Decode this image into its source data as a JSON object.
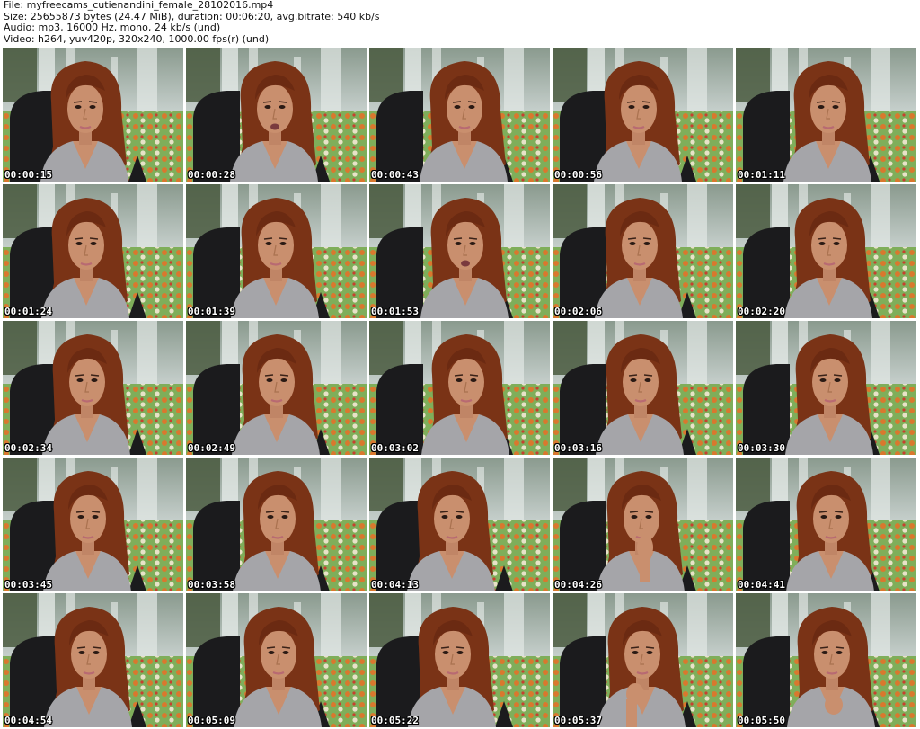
{
  "header": {
    "file": "File: myfreecams_cutienandini_female_28102016.mp4",
    "size": "Size: 25655873 bytes (24.47 MiB), duration: 00:06:20, avg.bitrate: 540 kb/s",
    "audio": "Audio: mp3, 16000 Hz, mono, 24 kb/s (und)",
    "video": "Video: h264, yuv420p, 320x240, 1000.00 fps(r) (und)"
  },
  "colors": {
    "background": "#ffffff",
    "timestamp_text": "#ffffff",
    "timestamp_outline": "#000000"
  },
  "thumbnails": [
    {
      "timestamp": "00:00:15",
      "pose": "neutral"
    },
    {
      "timestamp": "00:00:28",
      "pose": "talking"
    },
    {
      "timestamp": "00:00:43",
      "pose": "neutral"
    },
    {
      "timestamp": "00:00:56",
      "pose": "neutral"
    },
    {
      "timestamp": "00:01:11",
      "pose": "neutral"
    },
    {
      "timestamp": "00:01:24",
      "pose": "neutral"
    },
    {
      "timestamp": "00:01:39",
      "pose": "neutral"
    },
    {
      "timestamp": "00:01:53",
      "pose": "talking"
    },
    {
      "timestamp": "00:02:06",
      "pose": "neutral"
    },
    {
      "timestamp": "00:02:20",
      "pose": "neutral"
    },
    {
      "timestamp": "00:02:34",
      "pose": "neutral"
    },
    {
      "timestamp": "00:02:49",
      "pose": "neutral"
    },
    {
      "timestamp": "00:03:02",
      "pose": "neutral"
    },
    {
      "timestamp": "00:03:16",
      "pose": "neutral"
    },
    {
      "timestamp": "00:03:30",
      "pose": "neutral"
    },
    {
      "timestamp": "00:03:45",
      "pose": "neutral"
    },
    {
      "timestamp": "00:03:58",
      "pose": "neutral"
    },
    {
      "timestamp": "00:04:13",
      "pose": "neutral"
    },
    {
      "timestamp": "00:04:26",
      "pose": "hand-to-mouth"
    },
    {
      "timestamp": "00:04:41",
      "pose": "neutral"
    },
    {
      "timestamp": "00:04:54",
      "pose": "neutral"
    },
    {
      "timestamp": "00:05:09",
      "pose": "neutral"
    },
    {
      "timestamp": "00:05:22",
      "pose": "neutral"
    },
    {
      "timestamp": "00:05:37",
      "pose": "hand-to-neck"
    },
    {
      "timestamp": "00:05:50",
      "pose": "hand-to-chest"
    }
  ]
}
